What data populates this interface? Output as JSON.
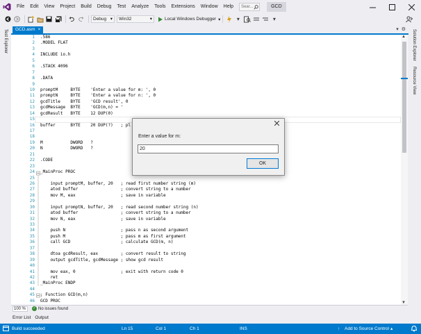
{
  "menubar": {
    "items": [
      "File",
      "Edit",
      "View",
      "Project",
      "Build",
      "Debug",
      "Test",
      "Analyze",
      "Tools",
      "Extensions",
      "Window",
      "Help"
    ],
    "search_placeholder": "Sear...",
    "solution_name": "GCD"
  },
  "toolbar": {
    "configuration": "Debug",
    "platform": "Win32",
    "debugger_label": "Local Windows Debugger"
  },
  "left_tabs": {
    "test_explorer": "Test Explorer"
  },
  "right_tabs": {
    "solution_explorer": "Solution Explorer",
    "resource_view": "Resource View"
  },
  "document": {
    "tab_label": "GCD.asm"
  },
  "editor": {
    "line_numbers": [
      "1",
      "2",
      "3",
      "4",
      "5",
      "6",
      "7",
      "8",
      "9",
      "10",
      "11",
      "12",
      "13",
      "14",
      "15",
      "16",
      "17",
      "18",
      "19",
      "20",
      "21",
      "22",
      "23",
      "24",
      "25",
      "26",
      "27",
      "28",
      "29",
      "30",
      "31",
      "32",
      "33",
      "34",
      "35",
      "36",
      "37",
      "38",
      "39",
      "40",
      "41",
      "42",
      "43",
      "44",
      "45",
      "46"
    ],
    "lines": [
      ".586",
      ".MODEL FLAT",
      "",
      "INCLUDE io.h",
      "",
      ".STACK 4096",
      "",
      ".DATA",
      "",
      "promptM     BYTE    'Enter a value for m: ', 0",
      "promptN     BYTE    'Enter a value for n: ', 0",
      "gcdTitle    BYTE    'GCD result', 0",
      "gcdMessage  BYTE    'GCD(m,n) = '",
      "gcdResult   BYTE    12 DUP(0)",
      "",
      "buffer      BYTE    20 DUP(?)   ; pl",
      "",
      "",
      "M           DWORD   ?",
      "N           DWORD   ?",
      "",
      ".CODE",
      "",
      "_MainProc PROC",
      "",
      "    input promptM, buffer, 20   ; read first number string (m)",
      "    atod buffer                 ; convert string to a number",
      "    mov M, eax                  ; save in variable",
      "",
      "    input promptN, buffer, 20   ; read second number string (n)",
      "    atod buffer                 ; convert string to a number",
      "    mov N, eax                  ; save in variable",
      "",
      "    push N                      ; pass n as second argument",
      "    push M                      ; pass m as first argument",
      "    call GCD                    ; calculate GCD(m, n)",
      "",
      "    dtoa gcdResult, eax         ; convert result to string",
      "    output gcdTitle, gcdMessage ; show gcd result",
      "",
      "    mov eax, 0                  ; exit with return code 0",
      "    ret",
      "_MainProc ENDP",
      "",
      "; Function GCD(m,n)",
      "GCD PROC"
    ]
  },
  "editor_status": {
    "zoom": "100 %",
    "issues": "No issues found"
  },
  "bottom_tabs": [
    "Error List",
    "Output"
  ],
  "statusbar": {
    "message": "Build succeeded",
    "line": "Ln 15",
    "col": "Col 1",
    "ch": "Ch 1",
    "mode": "INS",
    "source_control": "Add to Source Control"
  },
  "dialog": {
    "prompt": "Enter a value for m:",
    "input_value": "20",
    "ok_label": "OK"
  },
  "colors": {
    "accent": "#007acc",
    "line_number": "#2b91af",
    "success": "#388a34"
  }
}
